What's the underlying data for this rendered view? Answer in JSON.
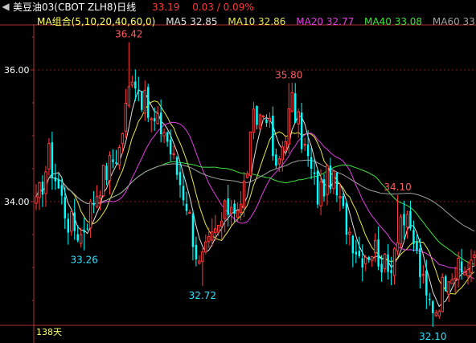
{
  "header": {
    "symbol_name": "美豆油03(CBOT ZLH8)日线",
    "last_price": "33.19",
    "change": "0.03 / 0.09%",
    "ma_group_label": "MA组合(5,10,20,40,60,0)",
    "ma_values": [
      {
        "label": "MA5 32.85",
        "color": "#e0e0e0"
      },
      {
        "label": "MA10 32.86",
        "color": "#e8e84a"
      },
      {
        "label": "MA20 32.77",
        "color": "#e040e0"
      },
      {
        "label": "MA40 33.08",
        "color": "#40e040"
      },
      {
        "label": "MA60 33.47",
        "color": "#a0a0a0"
      }
    ]
  },
  "colors": {
    "up": "#ff3b3b",
    "down": "#00ffff",
    "grid": "#8b1a1a",
    "axis_text": "#ffffff",
    "title": "#ffffff",
    "price": "#ff3b3b",
    "ma_group": "#ffff66",
    "label_high": "#ff5b5b",
    "label_low": "#33e0ff"
  },
  "chart_data": {
    "type": "candlestick",
    "ylim": [
      32.0,
      36.9
    ],
    "yticks": [
      "36.00",
      "34.00"
    ],
    "period_label": "138天",
    "annotations": [
      {
        "text": "36.42",
        "kind": "high"
      },
      {
        "text": "33.26",
        "kind": "low"
      },
      {
        "text": "32.72",
        "kind": "low"
      },
      {
        "text": "35.80",
        "kind": "high"
      },
      {
        "text": "34.10",
        "kind": "high"
      },
      {
        "text": "32.10",
        "kind": "low"
      }
    ],
    "keypoints": [
      {
        "i": 0,
        "p": 33.9
      },
      {
        "i": 4,
        "p": 34.7
      },
      {
        "i": 10,
        "p": 33.7
      },
      {
        "i": 14,
        "p": 33.5
      },
      {
        "i": 20,
        "p": 34.3
      },
      {
        "i": 26,
        "p": 34.8
      },
      {
        "i": 30,
        "p": 36.0
      },
      {
        "i": 33,
        "p": 35.6
      },
      {
        "i": 36,
        "p": 35.2
      },
      {
        "i": 40,
        "p": 35.1
      },
      {
        "i": 43,
        "p": 34.6
      },
      {
        "i": 47,
        "p": 34.0
      },
      {
        "i": 51,
        "p": 33.0
      },
      {
        "i": 53,
        "p": 33.2
      },
      {
        "i": 57,
        "p": 33.6
      },
      {
        "i": 61,
        "p": 34.0
      },
      {
        "i": 64,
        "p": 33.9
      },
      {
        "i": 68,
        "p": 35.2
      },
      {
        "i": 72,
        "p": 35.4
      },
      {
        "i": 75,
        "p": 34.4
      },
      {
        "i": 78,
        "p": 35.1
      },
      {
        "i": 80,
        "p": 35.5
      },
      {
        "i": 84,
        "p": 34.8
      },
      {
        "i": 88,
        "p": 34.1
      },
      {
        "i": 92,
        "p": 34.4
      },
      {
        "i": 96,
        "p": 33.8
      },
      {
        "i": 101,
        "p": 33.2
      },
      {
        "i": 106,
        "p": 33.3
      },
      {
        "i": 110,
        "p": 32.9
      },
      {
        "i": 114,
        "p": 33.8
      },
      {
        "i": 118,
        "p": 33.4
      },
      {
        "i": 122,
        "p": 32.5
      },
      {
        "i": 125,
        "p": 32.4
      },
      {
        "i": 129,
        "p": 33.0
      },
      {
        "i": 133,
        "p": 32.9
      },
      {
        "i": 137,
        "p": 33.19
      }
    ],
    "highs": [
      {
        "i": 29,
        "p": 36.42,
        "ann": 0
      },
      {
        "i": 79,
        "p": 35.8,
        "ann": 3
      },
      {
        "i": 113,
        "p": 34.1,
        "ann": 4
      }
    ],
    "lows": [
      {
        "i": 15,
        "p": 33.26,
        "ann": 1
      },
      {
        "i": 52,
        "p": 32.72,
        "ann": 2
      },
      {
        "i": 124,
        "p": 32.1,
        "ann": 5
      }
    ],
    "ma_periods": [
      5,
      10,
      20,
      40,
      60
    ],
    "ma_colors": [
      "#e0e0e0",
      "#e8e84a",
      "#e040e0",
      "#40e040",
      "#a0a0a0"
    ]
  }
}
